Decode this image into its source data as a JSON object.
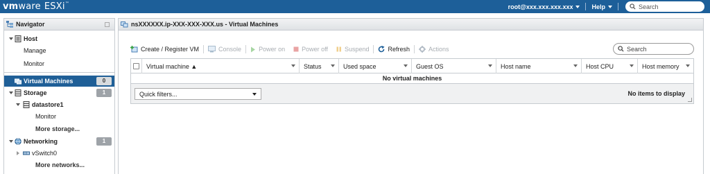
{
  "topbar": {
    "brand_vm": "vm",
    "brand_ware": "ware",
    "brand_product": "ESXi",
    "user": "root@xxx.xxx.xxx.xxx",
    "help": "Help",
    "search_placeholder": "Search"
  },
  "navigator": {
    "title": "Navigator",
    "items": [
      {
        "label": "Host"
      },
      {
        "label": "Manage"
      },
      {
        "label": "Monitor"
      },
      {
        "label": "Virtual Machines",
        "count": "0"
      },
      {
        "label": "Storage",
        "count": "1"
      },
      {
        "label": "datastore1"
      },
      {
        "label": "Monitor"
      },
      {
        "label": "More storage..."
      },
      {
        "label": "Networking",
        "count": "1"
      },
      {
        "label": "vSwitch0"
      },
      {
        "label": "More networks..."
      }
    ]
  },
  "main": {
    "title": "nsXXXXXX.ip-XXX-XXX-XXX.us - Virtual Machines",
    "toolbar": {
      "create": "Create / Register VM",
      "console": "Console",
      "power_on": "Power on",
      "power_off": "Power off",
      "suspend": "Suspend",
      "refresh": "Refresh",
      "actions": "Actions"
    },
    "search_placeholder": "Search",
    "columns": [
      "Virtual machine ▲",
      "Status",
      "Used space",
      "Guest OS",
      "Host name",
      "Host CPU",
      "Host memory"
    ],
    "empty_message": "No virtual machines",
    "quick_filters": "Quick filters...",
    "footer_status": "No items to display"
  },
  "colors": {
    "topbar": "#1d5f99",
    "selected": "#1f5f97",
    "count_badge": "#9ea3a8"
  }
}
